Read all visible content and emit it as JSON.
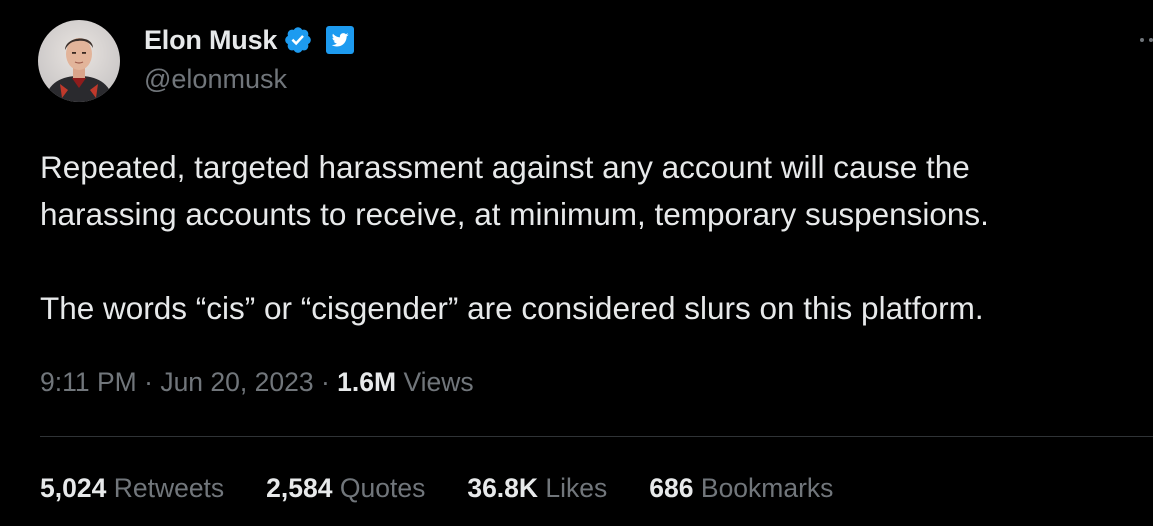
{
  "author": {
    "display_name": "Elon Musk",
    "handle": "@elonmusk",
    "avatar_icon": "profile-photo",
    "verified_icon": "verified-badge-icon",
    "affiliate_icon": "twitter-bird-icon",
    "verified_color": "#1d9bf0"
  },
  "tweet": {
    "line1": "Repeated, targeted harassment against any account will cause the",
    "line2": "harassing accounts to receive, at minimum, temporary suspensions.",
    "line3": "The words “cis” or “cisgender” are considered slurs on this platform."
  },
  "meta": {
    "time": "9:11 PM",
    "separator": "·",
    "date": "Jun 20, 2023",
    "views_count": "1.6M",
    "views_label": "Views"
  },
  "stats": [
    {
      "count": "5,024",
      "label": "Retweets"
    },
    {
      "count": "2,584",
      "label": "Quotes"
    },
    {
      "count": "36.8K",
      "label": "Likes"
    },
    {
      "count": "686",
      "label": "Bookmarks"
    }
  ],
  "colors": {
    "background": "#000000",
    "text_primary": "#e7e9ea",
    "text_secondary": "#71767b",
    "divider": "#2f3336",
    "accent": "#1d9bf0"
  }
}
